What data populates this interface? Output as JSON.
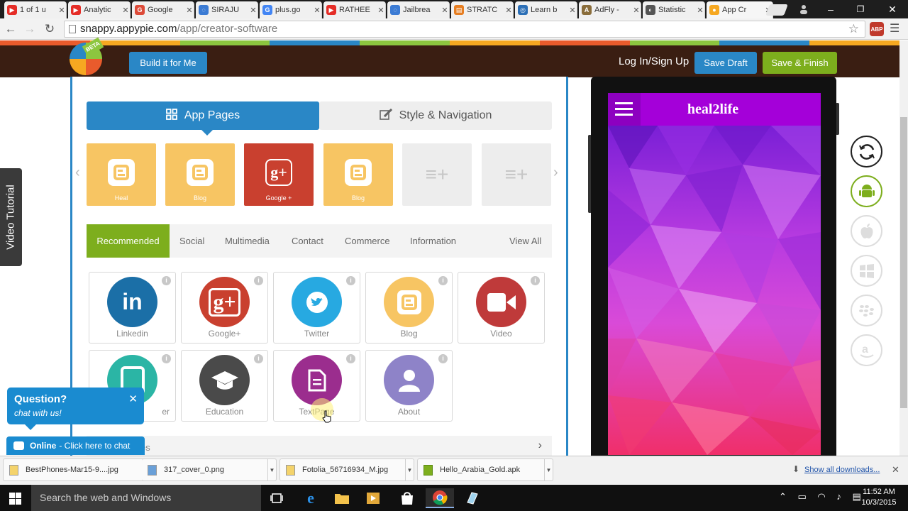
{
  "browser": {
    "tabs": [
      {
        "title": "1 of 1 u",
        "icon": "youtube-icon",
        "color": "#e52d27"
      },
      {
        "title": "Analytic",
        "icon": "youtube-icon",
        "color": "#e52d27"
      },
      {
        "title": "Google",
        "icon": "google-icon",
        "color": "#dd4b39"
      },
      {
        "title": "SIRAJU",
        "icon": "loading-icon",
        "color": "#3b7bd4"
      },
      {
        "title": "plus.go",
        "icon": "google-icon",
        "color": "#4285f4"
      },
      {
        "title": "RATHEE",
        "icon": "youtube-icon",
        "color": "#e52d27"
      },
      {
        "title": "Jailbrea",
        "icon": "loading-icon",
        "color": "#3b7bd4"
      },
      {
        "title": "STRATC",
        "icon": "page-icon",
        "color": "#e67e22"
      },
      {
        "title": "Learn b",
        "icon": "globe-icon",
        "color": "#2c6fb6"
      },
      {
        "title": "AdFly -",
        "icon": "adfly-icon",
        "color": "#8a6d3b"
      },
      {
        "title": "Statistic",
        "icon": "stats-icon",
        "color": "#555555"
      },
      {
        "title": "App Cr",
        "icon": "appypie-icon",
        "color": "#f6a821"
      }
    ],
    "url_host": "snappy.appypie.com",
    "url_path": "/app/creator-software",
    "abp_label": "ABP"
  },
  "header": {
    "build_button": "Build it for Me",
    "login_link": "Log In/Sign Up",
    "save_draft": "Save Draft",
    "save_finish": "Save & Finish",
    "logo_badge": "BETA",
    "colors": {
      "bar": "#3a1e12",
      "blue": "#2a87c6",
      "green": "#7dae1d"
    }
  },
  "editor": {
    "tab_pages": "App Pages",
    "tab_style": "Style & Navigation",
    "page_cards": [
      {
        "label": "Heal",
        "kind": "blog",
        "color": "#f7c563"
      },
      {
        "label": "Blog",
        "kind": "blog",
        "color": "#f7c563"
      },
      {
        "label": "Google +",
        "kind": "google",
        "color": "#c9402f"
      },
      {
        "label": "Blog",
        "kind": "blog",
        "color": "#f7c563"
      }
    ],
    "categories": [
      "Recommended",
      "Social",
      "Multimedia",
      "Contact",
      "Commerce",
      "Information",
      "View All"
    ],
    "features": [
      {
        "label": "Linkedin",
        "icon": "linkedin-icon",
        "color": "#1b6fa7"
      },
      {
        "label": "Google+",
        "icon": "google-plus-icon",
        "color": "#c9402f"
      },
      {
        "label": "Twitter",
        "icon": "twitter-icon",
        "color": "#27a9e1"
      },
      {
        "label": "Blog",
        "icon": "blog-icon",
        "color": "#f7c563"
      },
      {
        "label": "Video",
        "icon": "video-icon",
        "color": "#bf3a3a"
      },
      {
        "label": "er",
        "icon": "tablet-icon",
        "color": "#2bb5a5"
      },
      {
        "label": "Education",
        "icon": "graduation-cap-icon",
        "color": "#4a4a4a"
      },
      {
        "label": "TextPage",
        "icon": "document-icon",
        "color": "#9b2d8e"
      },
      {
        "label": "About",
        "icon": "person-icon",
        "color": "#8e83c8"
      }
    ],
    "more_label": "es"
  },
  "chat": {
    "title": "Question?",
    "subtitle": "chat with us!",
    "online": "Online",
    "online_cta": "- Click here to chat"
  },
  "video_tutorial": "Video Tutorial",
  "phone": {
    "app_title": "heal2life",
    "app_bar_color": "#a400d9"
  },
  "platforms": [
    "refresh-icon",
    "android-icon",
    "apple-icon",
    "windows-icon",
    "blackberry-icon",
    "amazon-icon"
  ],
  "downloads": {
    "items": [
      "BestPhones-Mar15-9....jpg",
      "317_cover_0.png",
      "Fotolia_56716934_M.jpg",
      "Hello_Arabia_Gold.apk"
    ],
    "show_all": "Show all downloads..."
  },
  "taskbar": {
    "search_placeholder": "Search the web and Windows",
    "time": "11:52 AM",
    "date": "10/3/2015"
  }
}
